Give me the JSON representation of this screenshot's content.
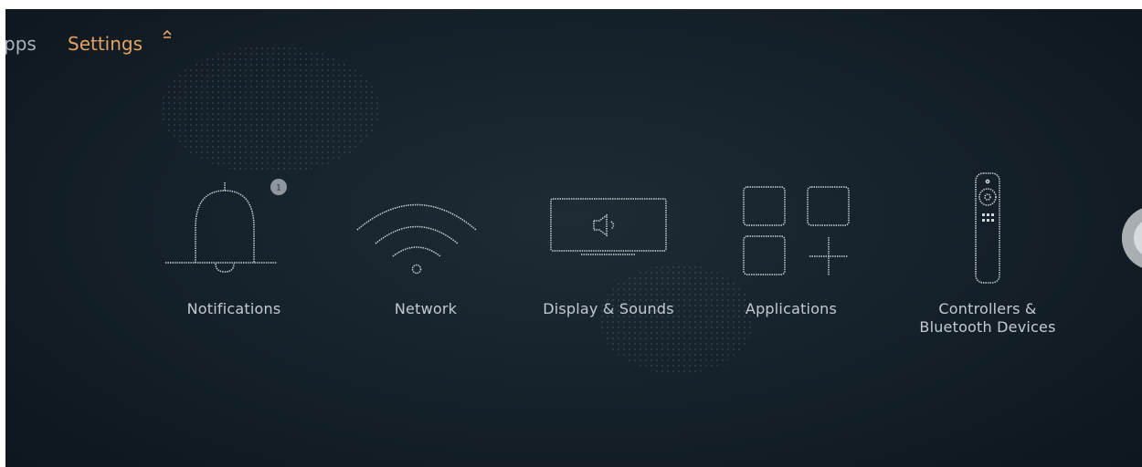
{
  "nav": {
    "apps_label": "pps",
    "settings_label": "Settings"
  },
  "settings_tiles": [
    {
      "label": "Notifications",
      "icon": "bell-icon",
      "badge": "1"
    },
    {
      "label": "Network",
      "icon": "wifi-icon"
    },
    {
      "label": "Display & Sounds",
      "icon": "display-speaker-icon"
    },
    {
      "label": "Applications",
      "icon": "apps-grid-icon"
    },
    {
      "label": "Controllers &\nBluetooth Devices",
      "icon": "remote-icon"
    }
  ],
  "colors": {
    "background": "#111c23",
    "nav_active": "#e6a163",
    "nav_inactive": "#aab3b9",
    "icon_stroke": "#d2d8dc",
    "label_text": "#c3cbd1"
  }
}
